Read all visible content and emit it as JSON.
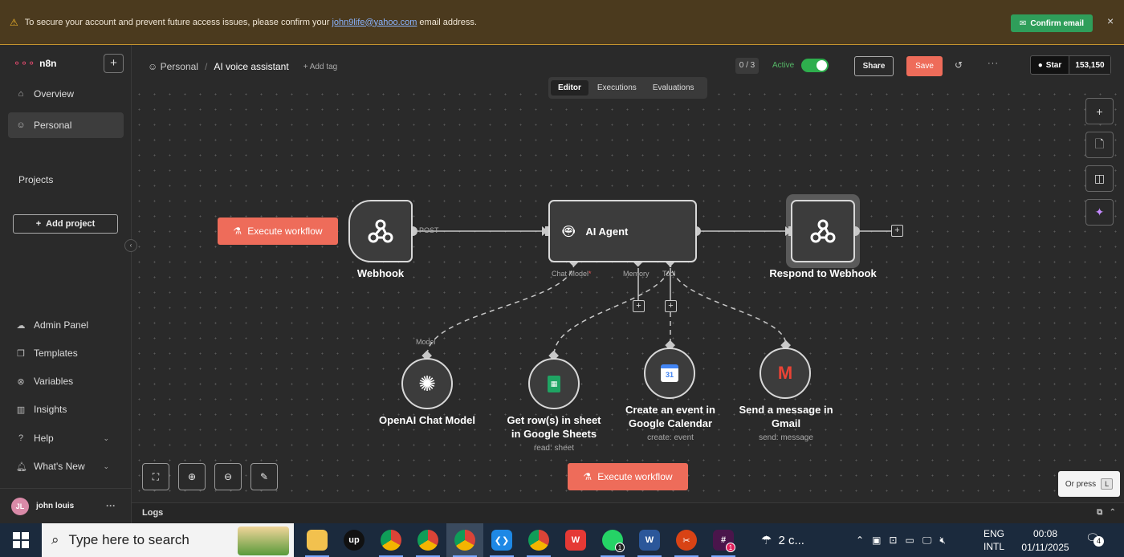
{
  "banner": {
    "message_before": "To secure your account and prevent future access issues, please confirm your",
    "email": "john9life@yahoo.com",
    "message_after": "email address.",
    "confirm_label": "Confirm email",
    "close": "×"
  },
  "sidebar": {
    "logo": "n8n",
    "new_button": "+",
    "items": [
      {
        "label": "Overview",
        "icon": "home-icon"
      },
      {
        "label": "Personal",
        "icon": "user-icon"
      }
    ],
    "projects_title": "Projects",
    "add_project": "Add project",
    "bottom_items": [
      {
        "label": "Admin Panel",
        "icon": "cloud-icon"
      },
      {
        "label": "Templates",
        "icon": "box-icon"
      },
      {
        "label": "Variables",
        "icon": "variable-icon"
      },
      {
        "label": "Insights",
        "icon": "chart-icon"
      },
      {
        "label": "Help",
        "icon": "help-icon"
      },
      {
        "label": "What's New",
        "icon": "bell-icon"
      }
    ],
    "user": {
      "initials": "JL",
      "name": "john louis"
    }
  },
  "header": {
    "breadcrumb_owner": "Personal",
    "workflow_title": "AI voice assistant",
    "add_tag": "+ Add tag",
    "counter": "0 / 3",
    "active_label": "Active",
    "active": true,
    "share": "Share",
    "save": "Save",
    "github_star": "Star",
    "github_count": "153,150"
  },
  "tabs": [
    "Editor",
    "Executions",
    "Evaluations"
  ],
  "canvas": {
    "execute_label": "Execute workflow",
    "nodes": {
      "webhook": {
        "label": "Webhook",
        "output_label": "POST"
      },
      "agent": {
        "label": "AI Agent",
        "ports": [
          "Chat Model",
          "Memory",
          "Tool"
        ]
      },
      "respond": {
        "label": "Respond to Webhook"
      },
      "openai": {
        "label": "OpenAI Chat Model",
        "port": "Model"
      },
      "sheets": {
        "label1": "Get row(s) in sheet",
        "label2": "in Google Sheets",
        "sub": "read: sheet"
      },
      "calendar": {
        "label1": "Create an event in",
        "label2": "Google Calendar",
        "sub": "create: event"
      },
      "gmail": {
        "label1": "Send a message in",
        "label2": "Gmail",
        "sub": "send: message"
      }
    },
    "or_press": "Or press",
    "or_press_key": "L"
  },
  "logs": {
    "label": "Logs"
  },
  "taskbar": {
    "search_placeholder": "Type here to search",
    "weather": "2 c...",
    "lang1": "ENG",
    "lang2": "INTL",
    "time": "00:08",
    "date": "01/11/2025",
    "notifications": "4",
    "apps": [
      {
        "name": "file-explorer-icon",
        "glyph": "",
        "color": "#f2c14e"
      },
      {
        "name": "upwork-icon",
        "glyph": "up",
        "color": "#111111"
      },
      {
        "name": "chrome-icon",
        "glyph": "",
        "color": "#db4437"
      },
      {
        "name": "chrome-profile-q-icon",
        "glyph": "",
        "color": "#db4437"
      },
      {
        "name": "chrome-profile-y-icon",
        "glyph": "",
        "color": "#db4437"
      },
      {
        "name": "vscode-icon",
        "glyph": "",
        "color": "#1e88e5"
      },
      {
        "name": "chrome-profile-p-icon",
        "glyph": "",
        "color": "#db4437"
      },
      {
        "name": "wps-icon",
        "glyph": "W",
        "color": "#e53935"
      },
      {
        "name": "whatsapp-icon",
        "glyph": "",
        "color": "#25d366"
      },
      {
        "name": "word-icon",
        "glyph": "W",
        "color": "#2b579a"
      },
      {
        "name": "snipping-tool-icon",
        "glyph": "",
        "color": "#d84315"
      },
      {
        "name": "slack-icon",
        "glyph": "",
        "color": "#4a154b"
      }
    ],
    "whatsapp_badge": "1",
    "slack_badge": "1"
  }
}
